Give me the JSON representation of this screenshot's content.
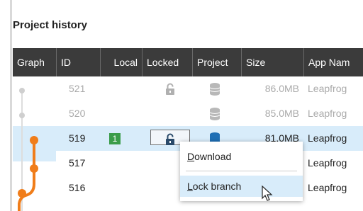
{
  "panel": {
    "title": "Project history"
  },
  "columns": [
    "Graph",
    "ID",
    "Local",
    "Locked",
    "Project",
    "Size",
    "App Nam"
  ],
  "rows": [
    {
      "id": "521",
      "local": "",
      "size": "86.0MB",
      "app": "Leapfrog",
      "state": "disabled"
    },
    {
      "id": "520",
      "local": "",
      "size": "85.0MB",
      "app": "Leapfrog",
      "state": "disabled"
    },
    {
      "id": "519",
      "local": "1",
      "size": "81.0MB",
      "app": "Leapfrog",
      "state": "selected"
    },
    {
      "id": "517",
      "local": "",
      "size": "",
      "app": "Leapfrog",
      "state": "normal"
    },
    {
      "id": "516",
      "local": "",
      "size": "",
      "app": "Leapfrog",
      "state": "normal"
    }
  ],
  "context_menu": {
    "items": [
      {
        "label": "Download",
        "mnemonic": "D",
        "rest": "ownload"
      },
      {
        "label": "Lock branch",
        "mnemonic": "L",
        "rest": "ock branch"
      }
    ]
  },
  "colors": {
    "accent": "#f07d1a",
    "header_bg": "#3b3b3b",
    "selected_row": "#d8ecfa",
    "local_badge": "#3a9c4a",
    "project_icon_selected": "#1f6fb5"
  },
  "icons": [
    "padlock-open-icon",
    "database-icon",
    "mouse-pointer-icon"
  ]
}
